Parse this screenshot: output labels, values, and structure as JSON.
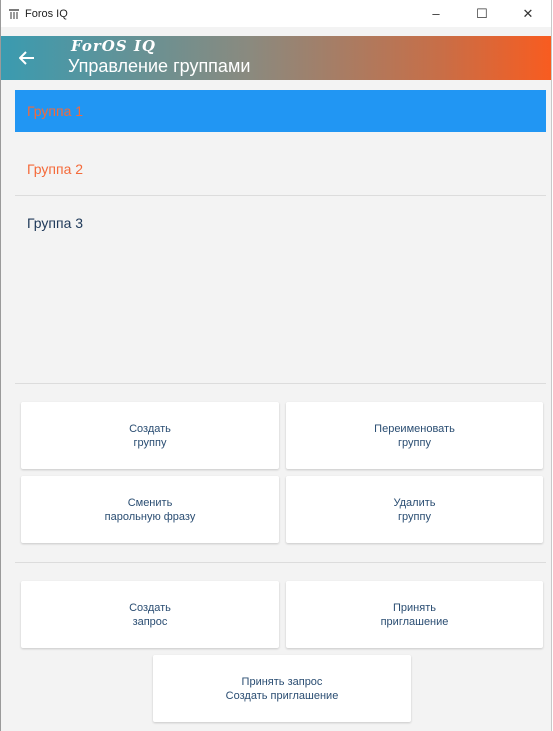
{
  "window": {
    "title": "Foros IQ",
    "minimize": "–",
    "maximize": "☐",
    "close": "✕"
  },
  "header": {
    "brand": "ForOS IQ",
    "title": "Управление группами"
  },
  "groups": [
    "Группа 1",
    "Группа 2",
    "Группа 3"
  ],
  "buttons": {
    "create_group": "Создать\nгруппу",
    "rename_group": "Переименовать\nгруппу",
    "change_passphrase": "Сменить\nпарольную фразу",
    "delete_group": "Удалить\nгруппу",
    "create_request": "Создать\nзапрос",
    "accept_invitation": "Принять\nприглашение",
    "accept_request_create_invitation": "Принять запрос\nСоздать приглашение"
  },
  "colors": {
    "selected_bg": "#2196f3",
    "accent": "#f46a3a",
    "text": "#2a4d72"
  }
}
